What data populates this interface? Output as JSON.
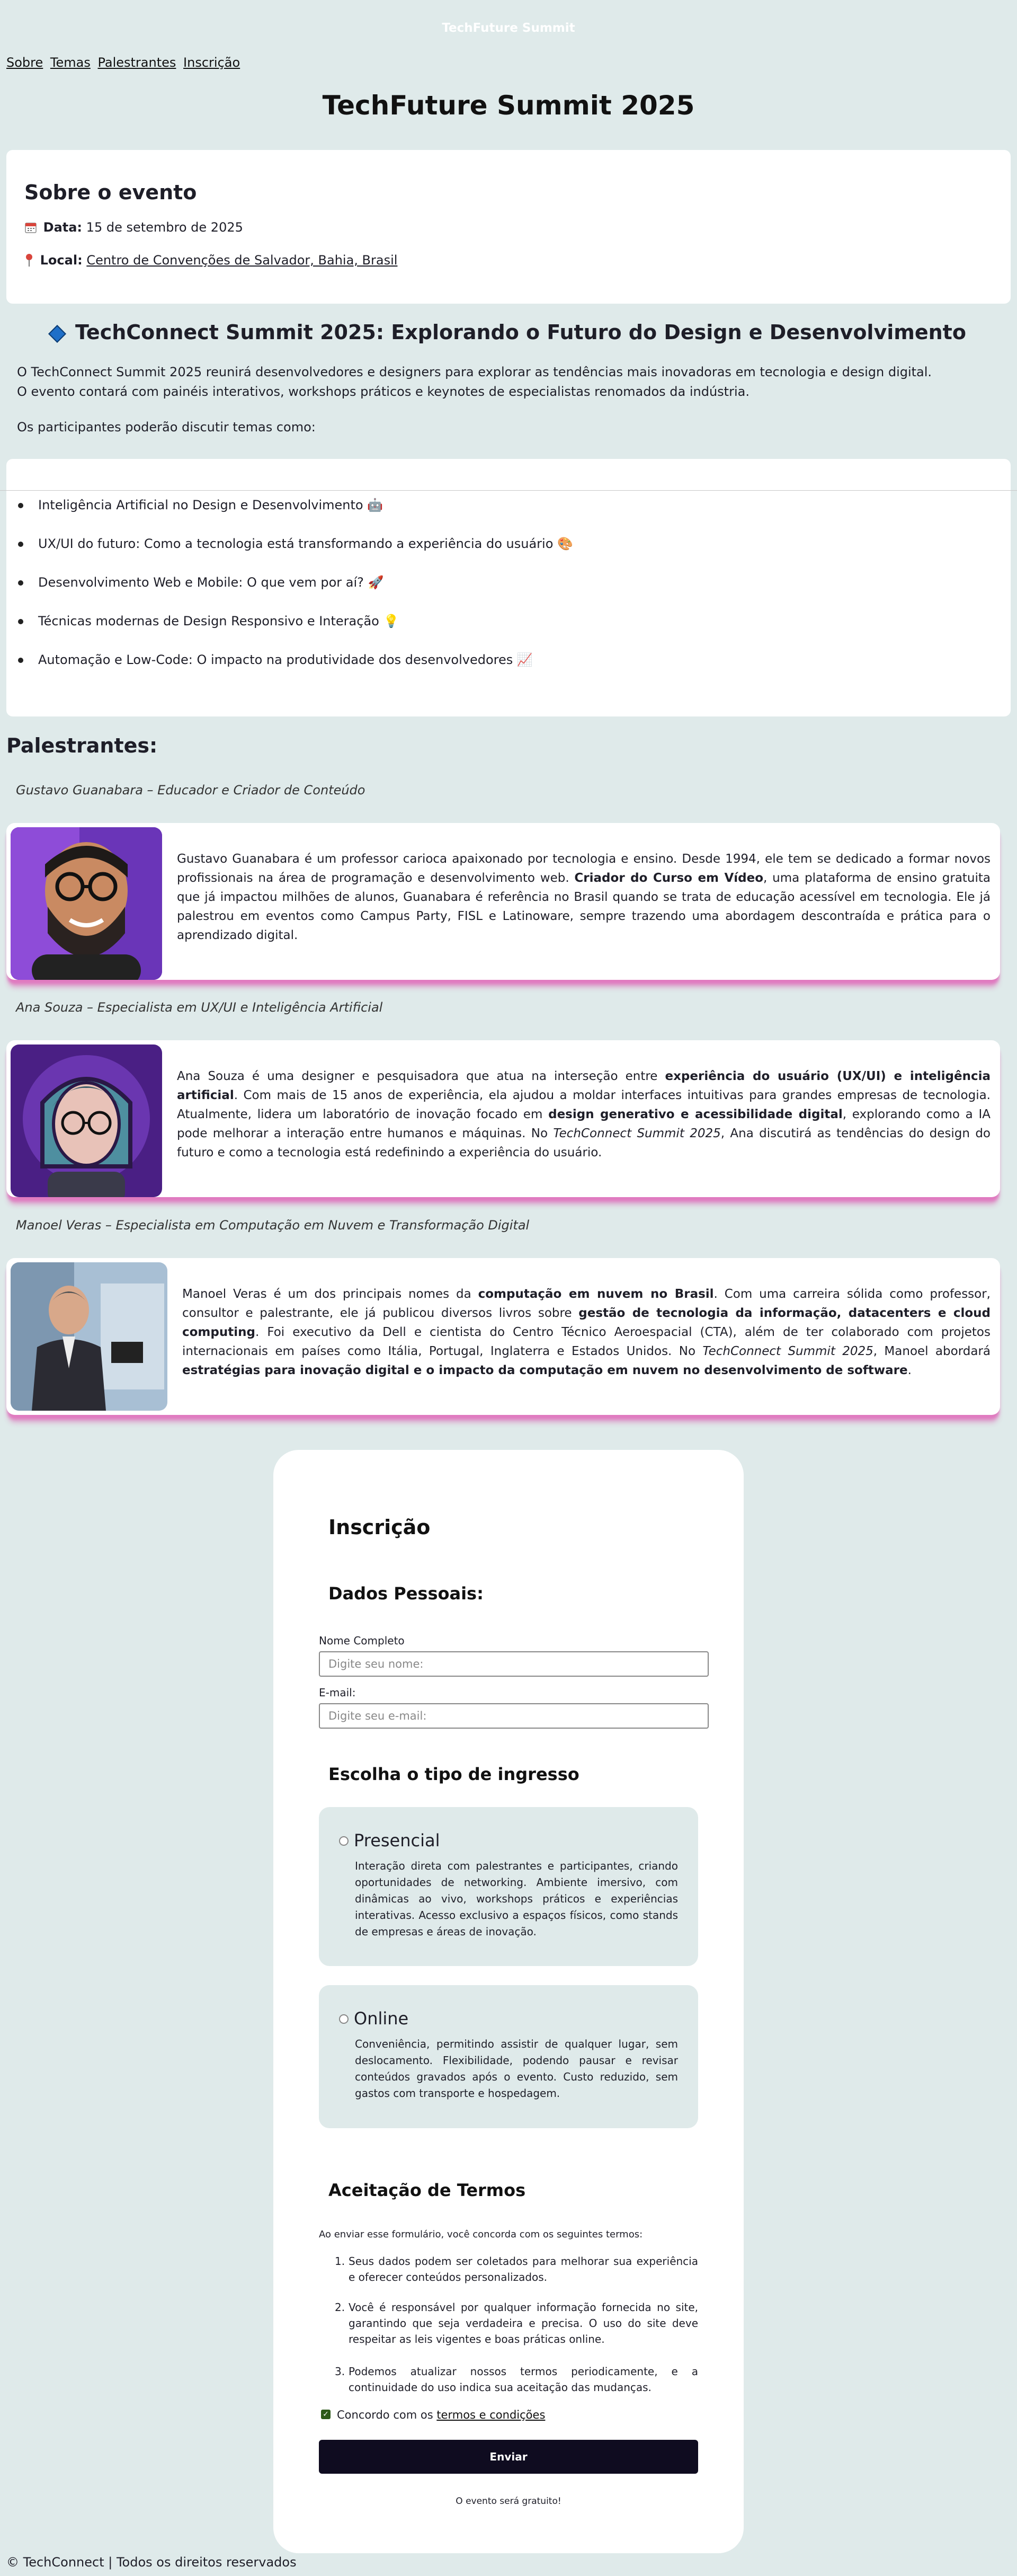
{
  "header": {
    "site_title": "TechFuture Summit"
  },
  "nav": {
    "items": [
      "Sobre",
      "Temas",
      "Palestrantes",
      "Inscrição"
    ]
  },
  "page_title": "TechFuture Summit 2025",
  "about": {
    "title": "Sobre o evento",
    "date_icon": "calendar-icon",
    "date_label": "Data:",
    "date_value": "15 de setembro de 2025",
    "location_icon": "pin-icon",
    "location_label": "Local:",
    "location_value": "Centro de Convenções de Salvador, Bahia, Brasil"
  },
  "summit": {
    "icon": "blue-diamond-icon",
    "title": "TechConnect Summit 2025: Explorando o Futuro do Design e Desenvolvimento",
    "intro_1": "O TechConnect Summit 2025 reunirá desenvolvedores e designers para explorar as tendências mais inovadoras em tecnologia e design digital.",
    "intro_2": "O evento contará com painéis interativos, workshops práticos e keynotes de especialistas renomados da indústria.",
    "topics_intro": "Os participantes poderão discutir temas como:",
    "topics": [
      {
        "text": "Inteligência Artificial no Design e Desenvolvimento",
        "emoji": "🤖"
      },
      {
        "text": "UX/UI do futuro: Como a tecnologia está transformando a experiência do usuário",
        "emoji": "🎨"
      },
      {
        "text": "Desenvolvimento Web e Mobile: O que vem por aí?",
        "emoji": "🚀"
      },
      {
        "text": "Técnicas modernas de Design Responsivo e Interação",
        "emoji": "💡"
      },
      {
        "text": "Automação e Low-Code: O impacto na produtividade dos desenvolvedores",
        "emoji": "📈"
      }
    ]
  },
  "speakers": {
    "heading": "Palestrantes:",
    "list": [
      {
        "title": "Gustavo Guanabara – Educador e Criador de Conteúdo",
        "bio_a": "Gustavo Guanabara é um professor carioca apaixonado por tecnologia e ensino. Desde 1994, ele tem se dedicado a formar novos profissionais na área de programação e desenvolvimento web. ",
        "bio_b": "Criador do Curso em Vídeo",
        "bio_c": ", uma plataforma de ensino gratuita que já impactou milhões de alunos, Guanabara é referência no Brasil quando se trata de educação acessível em tecnologia. Ele já palestrou em eventos como Campus Party, FISL e Latinoware, sempre trazendo uma abordagem descontraída e prática para o aprendizado digital."
      },
      {
        "title": "Ana Souza – Especialista em UX/UI e Inteligência Artificial",
        "bio_a": "Ana Souza é uma designer e pesquisadora que atua na interseção entre ",
        "bio_b": "experiência do usuário (UX/UI) e inteligência artificial",
        "bio_c": ". Com mais de 15 anos de experiência, ela ajudou a moldar interfaces intuitivas para grandes empresas de tecnologia. Atualmente, lidera um laboratório de inovação focado em ",
        "bio_d": "design generativo e acessibilidade digital",
        "bio_e": ", explorando como a IA pode melhorar a interação entre humanos e máquinas. No ",
        "bio_f": "TechConnect Summit 2025",
        "bio_g": ", Ana discutirá as tendências do design do futuro e como a tecnologia está redefinindo a experiência do usuário."
      },
      {
        "title": "Manoel Veras – Especialista em Computação em Nuvem e Transformação Digital",
        "bio_a": "Manoel Veras é um dos principais nomes da ",
        "bio_b": "computação em nuvem no Brasil",
        "bio_c": ". Com uma carreira sólida como professor, consultor e palestrante, ele já publicou diversos livros sobre ",
        "bio_d": "gestão de tecnologia da informação, datacenters e cloud computing",
        "bio_e": ". Foi executivo da Dell e cientista do Centro Técnico Aeroespacial (CTA), além de ter colaborado com projetos internacionais em países como Itália, Portugal, Inglaterra e Estados Unidos. No ",
        "bio_f": "TechConnect Summit 2025",
        "bio_g": ", Manoel abordará ",
        "bio_h": "estratégias para inovação digital e o impacto da computação em nuvem no desenvolvimento de software",
        "bio_i": "."
      }
    ]
  },
  "form": {
    "title": "Inscrição",
    "personal_heading": "Dados Pessoais:",
    "name_label": "Nome Completo",
    "name_placeholder": "Digite seu nome:",
    "email_label": "E-mail:",
    "email_placeholder": "Digite seu e-mail:",
    "ticket_heading": "Escolha o tipo de ingresso",
    "options": [
      {
        "title": "Presencial",
        "desc": "Interação direta com palestrantes e participantes, criando oportunidades de networking. Ambiente imersivo, com dinâmicas ao vivo, workshops práticos e experiências interativas. Acesso exclusivo a espaços físicos, como stands de empresas e áreas de inovação."
      },
      {
        "title": "Online",
        "desc": "Conveniência, permitindo assistir de qualquer lugar, sem deslocamento. Flexibilidade, podendo pausar e revisar conteúdos gravados após o evento. Custo reduzido, sem gastos com transporte e hospedagem."
      }
    ],
    "terms_heading": "Aceitação de Termos",
    "terms_intro": "Ao enviar esse formulário, você concorda com os seguintes termos:",
    "terms": [
      "Seus dados podem ser coletados para melhorar sua experiência e oferecer conteúdos personalizados.",
      "Você é responsável por qualquer informação fornecida no site, garantindo que seja verdadeira e precisa. O uso do site deve respeitar as leis vigentes e boas práticas online.",
      "Podemos atualizar nossos termos periodicamente, e a continuidade do uso indica sua aceitação das mudanças."
    ],
    "agree_prefix": "Concordo com os ",
    "agree_link": "termos e condições",
    "submit": "Enviar",
    "free_note": "O evento será gratuito!"
  },
  "footer": "© TechConnect | Todos os direitos reservados"
}
